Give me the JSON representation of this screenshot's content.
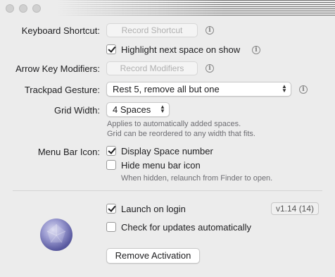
{
  "window": {
    "controls": [
      "close",
      "minimize",
      "zoom"
    ]
  },
  "keyboard_shortcut": {
    "label": "Keyboard Shortcut:",
    "button": "Record Shortcut",
    "info_icon": "info-circle"
  },
  "highlight": {
    "label": "Highlight next space on show",
    "checked": true,
    "info_icon": "info-circle"
  },
  "arrow_modifiers": {
    "label": "Arrow Key Modifiers:",
    "button": "Record Modifiers",
    "info_icon": "info-circle"
  },
  "trackpad": {
    "label": "Trackpad Gesture:",
    "value": "Rest 5, remove all but one",
    "info_icon": "info-circle"
  },
  "grid_width": {
    "label": "Grid Width:",
    "value": "4 Spaces",
    "help_line1": "Applies to automatically added spaces.",
    "help_line2": "Grid can be reordered to any width that fits."
  },
  "menu_bar": {
    "label": "Menu Bar Icon:",
    "display_number": {
      "label": "Display Space number",
      "checked": true
    },
    "hide_icon": {
      "label": "Hide menu bar icon",
      "checked": false
    },
    "help": "When hidden, relaunch from Finder to open."
  },
  "launch_on_login": {
    "label": "Launch on login",
    "checked": true
  },
  "version": "v1.14 (14)",
  "check_updates": {
    "label": "Check for updates automatically",
    "checked": false
  },
  "remove_activation": "Remove Activation",
  "app_icon": "app-logo-icon"
}
